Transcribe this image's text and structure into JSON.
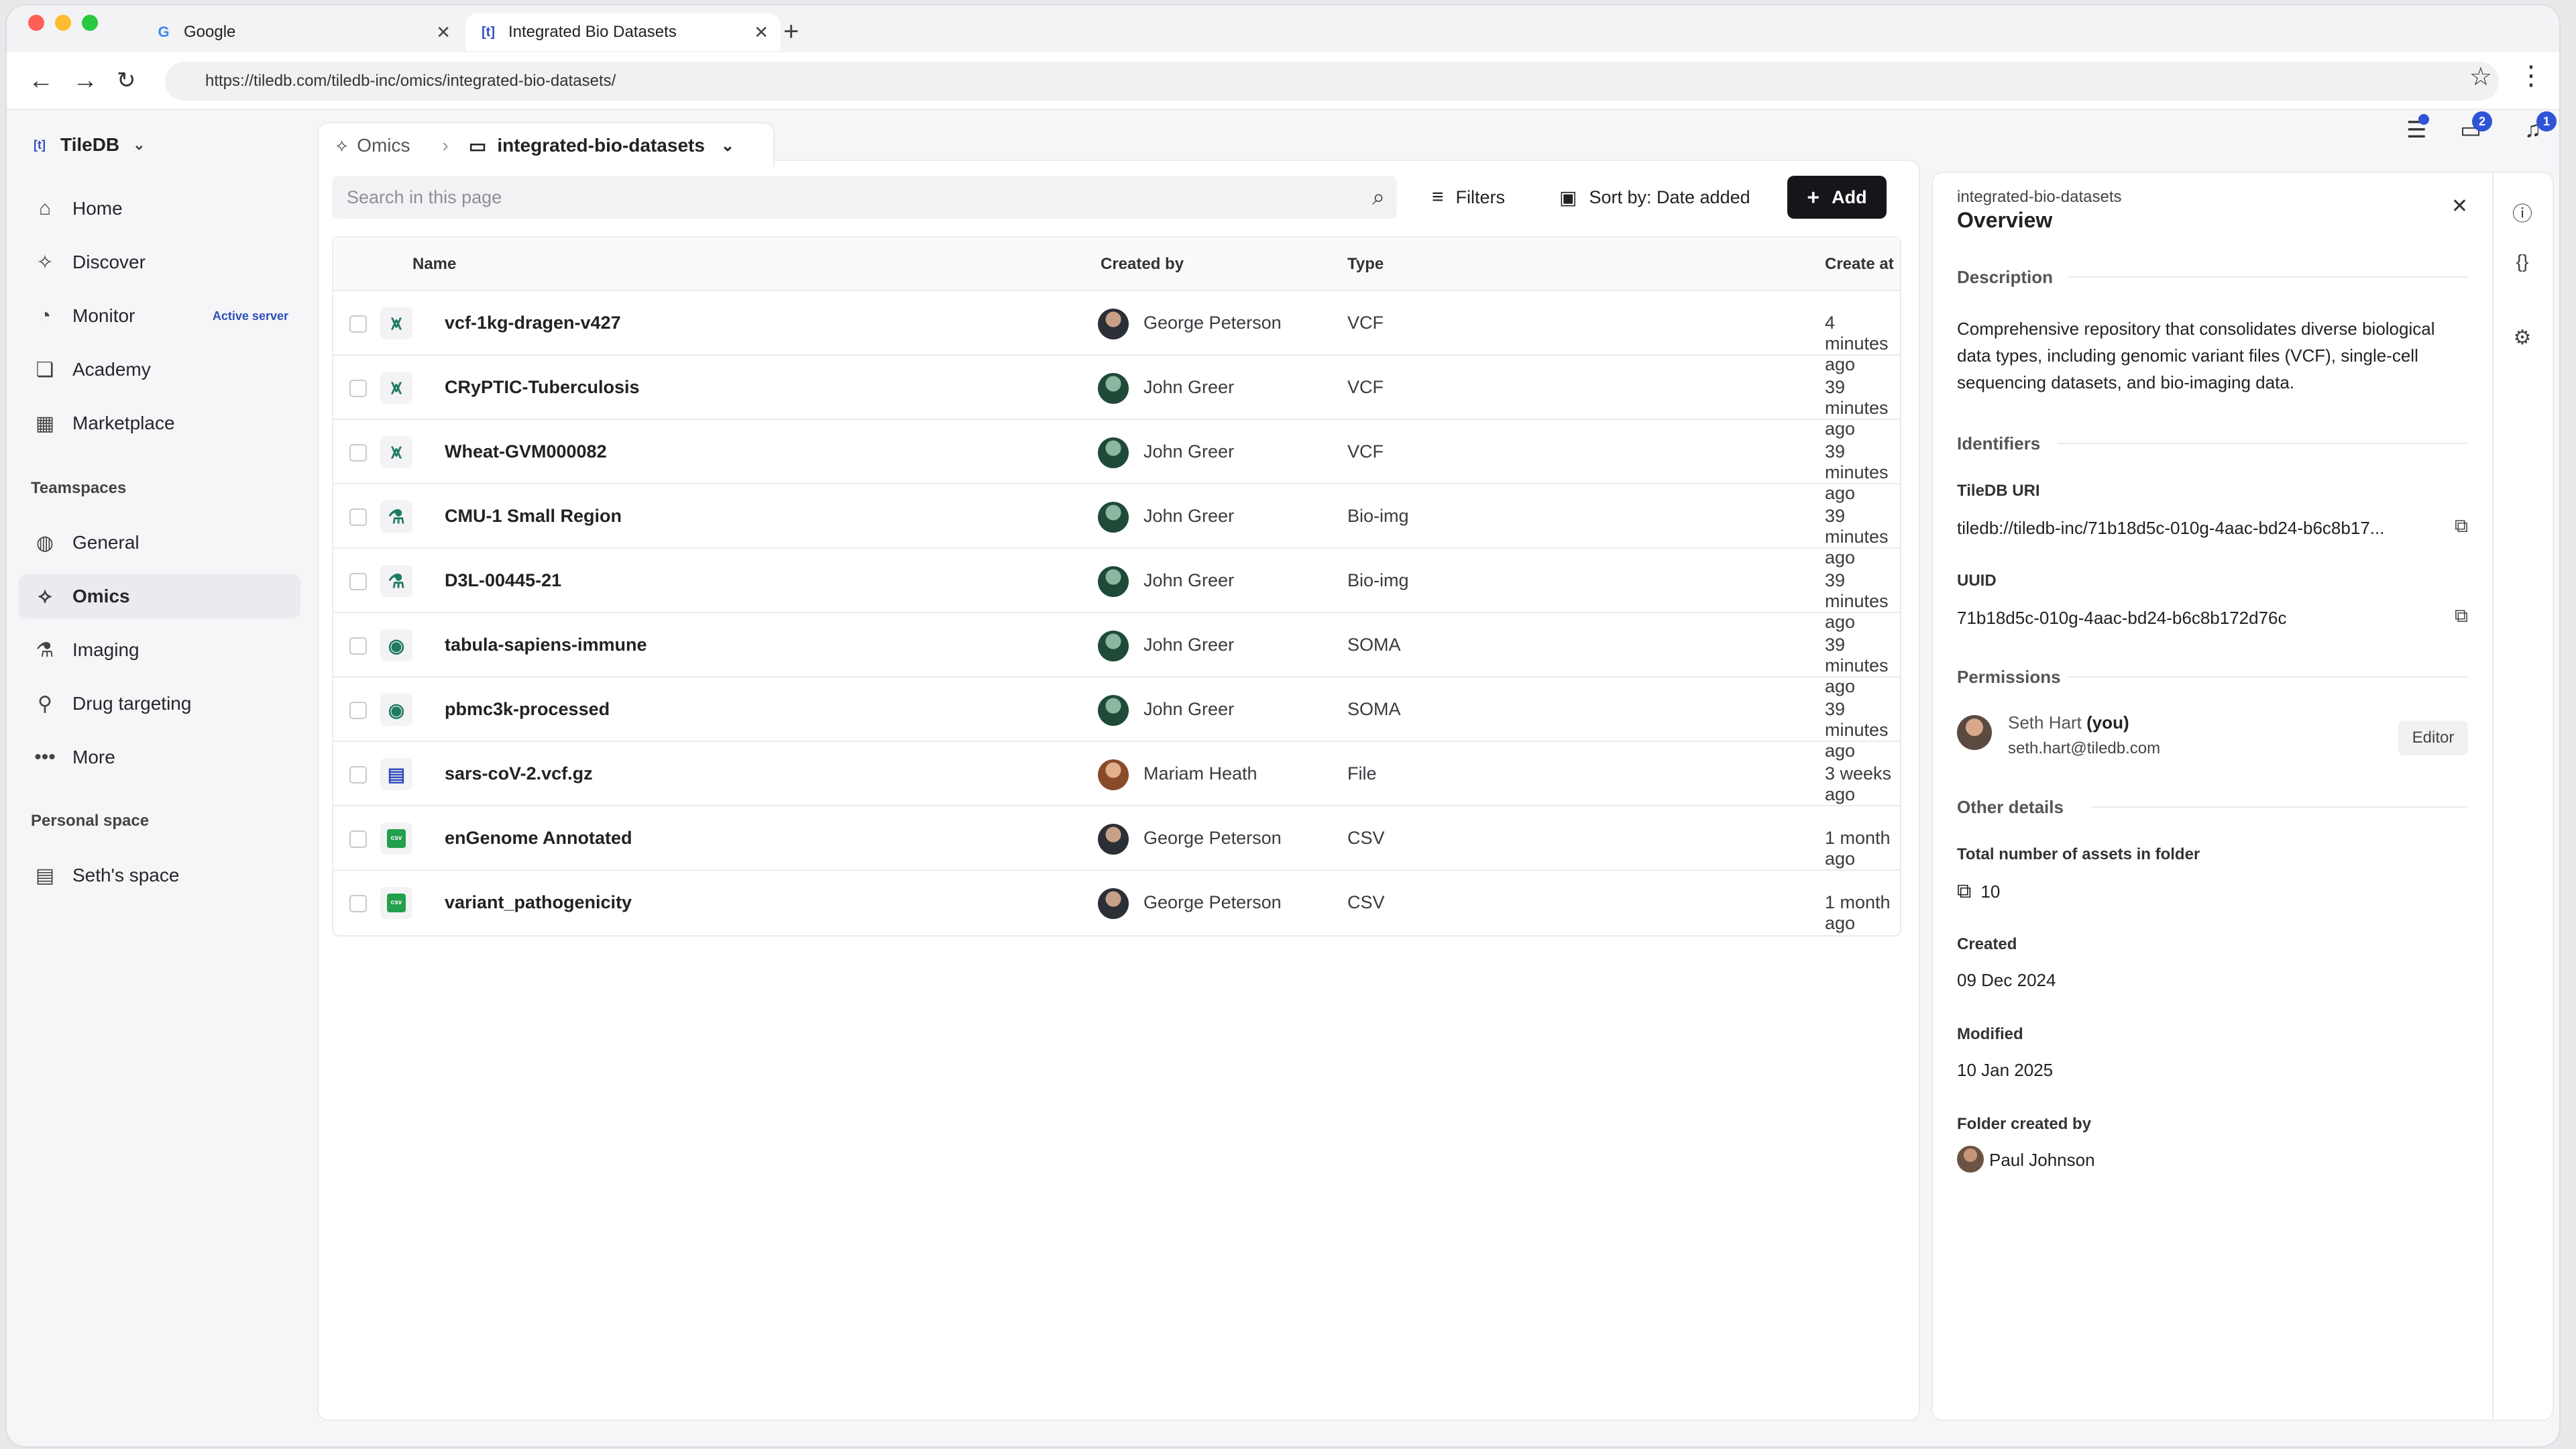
{
  "browser": {
    "tabs": [
      {
        "title": "Google",
        "icon": "G"
      },
      {
        "title": "Integrated Bio Datasets",
        "icon": "[t]"
      }
    ],
    "url": "https://tiledb.com/tiledb-inc/omics/integrated-bio-datasets/"
  },
  "sidebar": {
    "org": "TileDB",
    "org_logo": "[t]",
    "items": [
      {
        "label": "Home"
      },
      {
        "label": "Discover"
      },
      {
        "label": "Monitor",
        "badge": "Active server"
      },
      {
        "label": "Academy"
      },
      {
        "label": "Marketplace"
      }
    ],
    "teamspaces_heading": "Teamspaces",
    "teamspaces": [
      {
        "label": "General"
      },
      {
        "label": "Omics"
      },
      {
        "label": "Imaging"
      },
      {
        "label": "Drug targeting"
      },
      {
        "label": "More"
      }
    ],
    "personal_heading": "Personal space",
    "personal": [
      {
        "label": "Seth's space"
      }
    ]
  },
  "header": {
    "notif_badges": [
      "2",
      "1"
    ]
  },
  "breadcrumb": {
    "parent": "Omics",
    "current": "integrated-bio-datasets"
  },
  "toolbar": {
    "search_placeholder": "Search in this page",
    "filters": "Filters",
    "sort": "Sort by: Date added",
    "add": "Add"
  },
  "table": {
    "columns": [
      "Name",
      "Created by",
      "Type",
      "Create at"
    ],
    "rows": [
      {
        "name": "vcf-1kg-dragen-v427",
        "creator": "George Peterson",
        "type": "VCF",
        "created": "4 minutes ago",
        "icon": "vcf"
      },
      {
        "name": "CRyPTIC-Tuberculosis",
        "creator": "John Greer",
        "type": "VCF",
        "created": "39 minutes ago",
        "icon": "vcf"
      },
      {
        "name": "Wheat-GVM000082",
        "creator": "John Greer",
        "type": "VCF",
        "created": "39 minutes ago",
        "icon": "vcf"
      },
      {
        "name": "CMU-1 Small Region",
        "creator": "John Greer",
        "type": "Bio-img",
        "created": "39 minutes ago",
        "icon": "bioimg"
      },
      {
        "name": "D3L-00445-21",
        "creator": "John Greer",
        "type": "Bio-img",
        "created": "39 minutes ago",
        "icon": "bioimg"
      },
      {
        "name": "tabula-sapiens-immune",
        "creator": "John Greer",
        "type": "SOMA",
        "created": "39 minutes ago",
        "icon": "soma"
      },
      {
        "name": "pbmc3k-processed",
        "creator": "John Greer",
        "type": "SOMA",
        "created": "39 minutes ago",
        "icon": "soma"
      },
      {
        "name": "sars-coV-2.vcf.gz",
        "creator": "Mariam Heath",
        "type": "File",
        "created": "3 weeks ago",
        "icon": "file"
      },
      {
        "name": "enGenome Annotated",
        "creator": "George Peterson",
        "type": "CSV",
        "created": "1 month ago",
        "icon": "csv"
      },
      {
        "name": "variant_pathogenicity",
        "creator": "George Peterson",
        "type": "CSV",
        "created": "1 month ago",
        "icon": "csv"
      }
    ]
  },
  "panel": {
    "subtitle": "integrated-bio-datasets",
    "title": "Overview",
    "description_heading": "Description",
    "description": "Comprehensive repository that consolidates diverse biological data types, including genomic variant files (VCF), single-cell sequencing datasets, and bio-imaging data.",
    "identifiers_heading": "Identifiers",
    "uri_label": "TileDB URI",
    "uri_value": "tiledb://tiledb-inc/71b18d5c-010g-4aac-bd24-b6c8b17...",
    "uuid_label": "UUID",
    "uuid_value": "71b18d5c-010g-4aac-bd24-b6c8b172d76c",
    "permissions_heading": "Permissions",
    "user_name": "Seth Hart",
    "user_you": "(you)",
    "user_email": "seth.hart@tiledb.com",
    "user_role": "Editor",
    "other_heading": "Other details",
    "assets_label": "Total number of assets in folder",
    "assets_value": "10",
    "created_label": "Created",
    "created_value": "09 Dec 2024",
    "modified_label": "Modified",
    "modified_value": "10 Jan 2025",
    "folder_by_label": "Folder created by",
    "folder_by_value": "Paul Johnson"
  },
  "colors": {
    "accent": "#2f54d6",
    "vcf": "#1f7a62",
    "csv": "#22a04b",
    "file": "#2d4db8"
  }
}
